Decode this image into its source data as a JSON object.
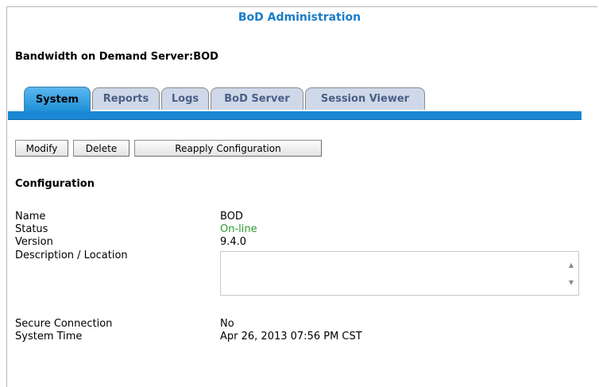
{
  "app": {
    "title": "BoD Administration"
  },
  "server": {
    "heading": "Bandwidth on Demand Server:BOD"
  },
  "tabs": [
    {
      "label": "System",
      "active": true
    },
    {
      "label": "Reports",
      "active": false
    },
    {
      "label": "Logs",
      "active": false
    },
    {
      "label": "BoD Server",
      "active": false
    },
    {
      "label": "Session Viewer",
      "active": false
    }
  ],
  "toolbar": {
    "modify_label": "Modify",
    "delete_label": "Delete",
    "reapply_label": "Reapply Configuration"
  },
  "config": {
    "section_title": "Configuration",
    "name_label": "Name",
    "name_value": "BOD",
    "status_label": "Status",
    "status_value": "On-line",
    "version_label": "Version",
    "version_value": "9.4.0",
    "description_label": "Description / Location",
    "description_value": "",
    "secure_label": "Secure Connection",
    "secure_value": "No",
    "time_label": "System Time",
    "time_value": "Apr 26, 2013 07:56 PM CST"
  },
  "colors": {
    "accent": "#1a88d4",
    "title": "#1a7cc7",
    "status_online": "#2c9b2c"
  }
}
